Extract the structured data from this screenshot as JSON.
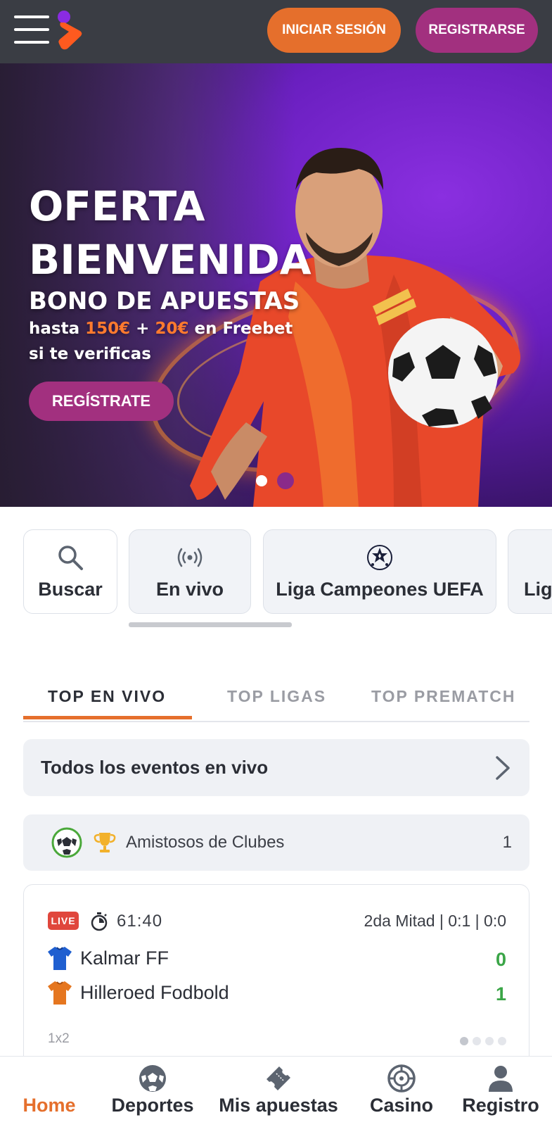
{
  "header": {
    "login_label": "INICIAR SESIÓN",
    "register_label": "REGISTRARSE"
  },
  "hero": {
    "title_line1": "OFERTA",
    "title_line2": "BIENVENIDA",
    "subtitle": "BONO DE APUESTAS",
    "offer_prefix": "hasta",
    "offer_amount1": "150€",
    "offer_plus": "+",
    "offer_amount2": "20€",
    "offer_suffix": "en Freebet",
    "offer_line2": "si te verificas",
    "cta_label": "REGÍSTRATE",
    "slides_total": 2,
    "active_slide": 1
  },
  "quick_links": [
    {
      "label": "Buscar",
      "icon": "search-icon"
    },
    {
      "label": "En vivo",
      "icon": "live-broadcast-icon"
    },
    {
      "label": "Liga Campeones UEFA",
      "icon": "champions-league-icon"
    },
    {
      "label": "Lig",
      "icon": "league-icon"
    }
  ],
  "tabs": [
    {
      "label": "TOP EN VIVO",
      "active": true
    },
    {
      "label": "TOP LIGAS",
      "active": false
    },
    {
      "label": "TOP PREMATCH",
      "active": false
    }
  ],
  "all_live": {
    "label": "Todos los eventos en vivo"
  },
  "league": {
    "name": "Amistosos de Clubes",
    "count": "1"
  },
  "match": {
    "live_label": "LIVE",
    "time": "61:40",
    "period": "2da Mitad  |  0:1  |  0:0",
    "home_team": "Kalmar FF",
    "away_team": "Hilleroed Fodbold",
    "home_score": "0",
    "away_score": "1",
    "market": "1x2",
    "colors": {
      "home_shirt": "#1f5fd0",
      "away_shirt": "#e5761f",
      "score": "#3aa547"
    }
  },
  "bottom_nav": [
    {
      "label": "Home",
      "icon": "home",
      "active": true
    },
    {
      "label": "Deportes",
      "icon": "soccer-ball-icon",
      "active": false
    },
    {
      "label": "Mis apuestas",
      "icon": "ticket-icon",
      "active": false
    },
    {
      "label": "Casino",
      "icon": "roulette-icon",
      "active": false
    },
    {
      "label": "Registro",
      "icon": "user-icon",
      "active": false
    }
  ],
  "colors": {
    "accent_orange": "#e56f2c",
    "accent_purple": "#a2307f",
    "header_bg": "#3a3d44"
  }
}
